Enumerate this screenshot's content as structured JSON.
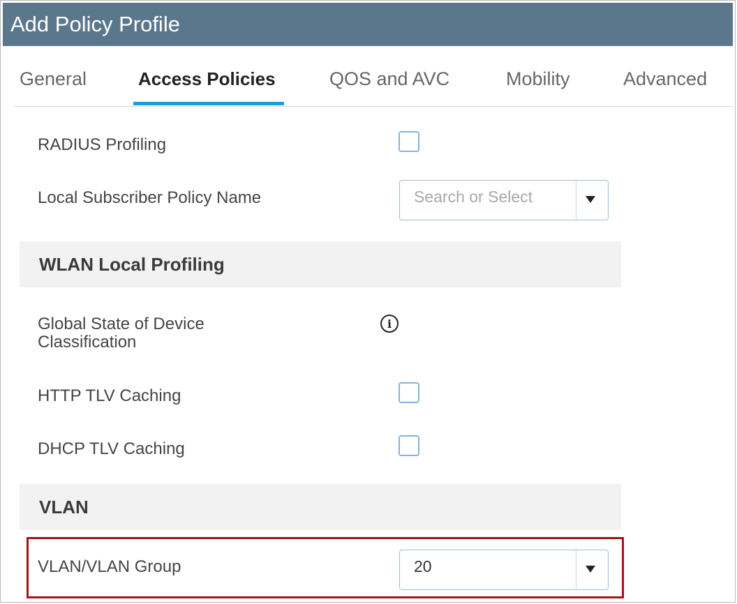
{
  "title": "Add Policy Profile",
  "tabs": [
    {
      "label": "General"
    },
    {
      "label": "Access Policies"
    },
    {
      "label": "QOS and AVC"
    },
    {
      "label": "Mobility"
    },
    {
      "label": "Advanced"
    }
  ],
  "active_tab": "Access Policies",
  "fields": {
    "radius_profiling": {
      "label": "RADIUS Profiling",
      "checked": false
    },
    "local_subscriber": {
      "label": "Local Subscriber Policy Name",
      "placeholder": "Search or Select"
    },
    "global_state_line1": "Global State of Device",
    "global_state_line2": "Classification",
    "info_icon_glyph": "i",
    "http_tlv": {
      "label": "HTTP TLV Caching",
      "checked": false
    },
    "dhcp_tlv": {
      "label": "DHCP TLV Caching",
      "checked": false
    },
    "vlan_group": {
      "label": "VLAN/VLAN Group",
      "value": "20"
    }
  },
  "sections": {
    "wlan_local_profiling": "WLAN Local Profiling",
    "vlan": "VLAN"
  },
  "colors": {
    "titlebar": "#5b778c",
    "tab_accent": "#1a9fd9",
    "highlight": "#a3141c",
    "checkbox_border": "#85b3d9"
  },
  "icons": {
    "info": "info-circle-icon",
    "dropdown": "caret-down-icon"
  }
}
